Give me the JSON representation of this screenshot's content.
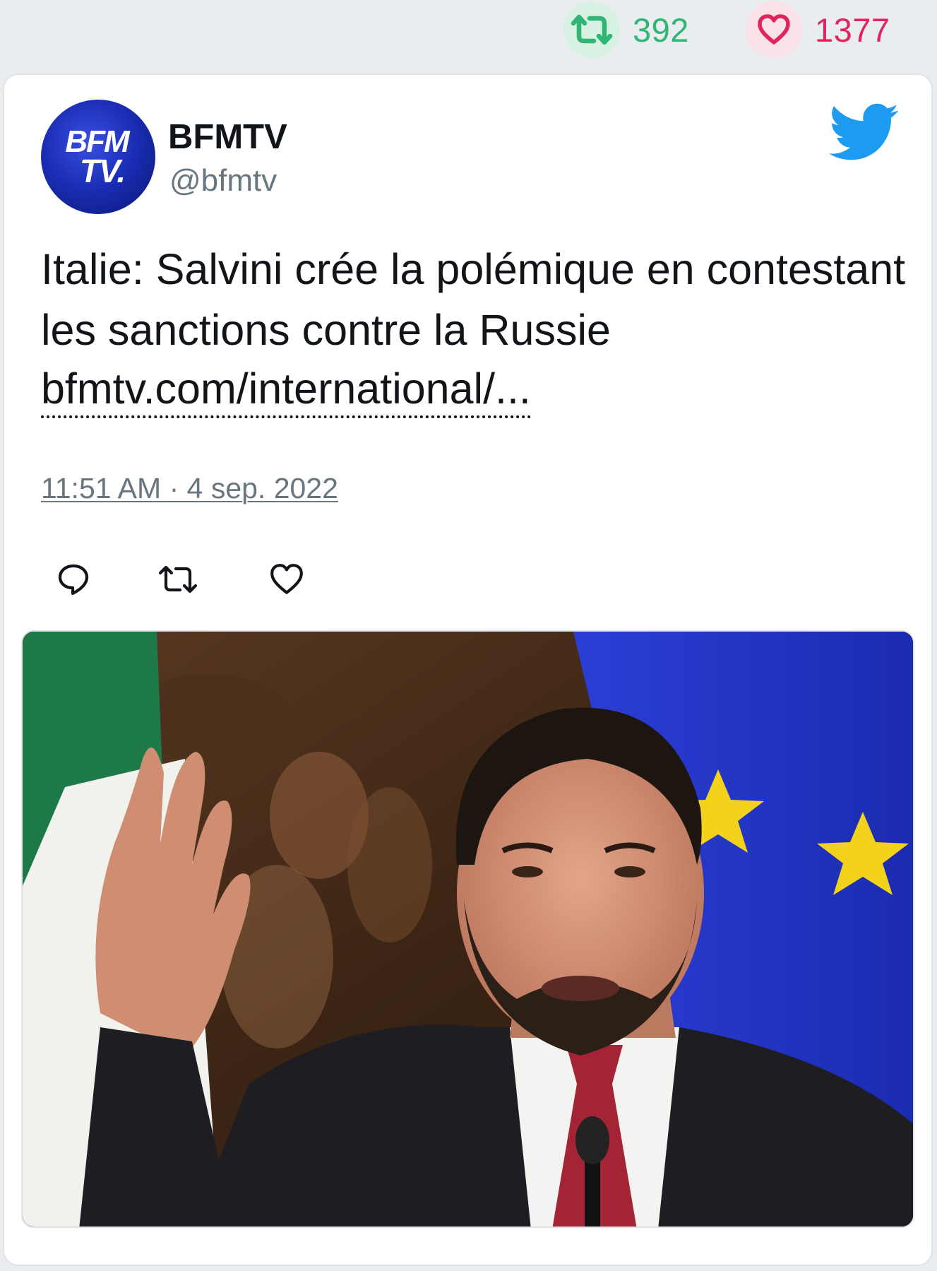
{
  "stats": {
    "retweets": "392",
    "likes": "1377"
  },
  "tweet": {
    "author_name": "BFMTV",
    "author_handle": "@bfmtv",
    "avatar_text_line1": "BFM",
    "avatar_text_line2": "TV.",
    "text": "Italie: Salvini crée la polémique en contestant les sanctions contre la Russie",
    "link": "bfmtv.com/international/...",
    "timestamp": "11:51 AM · 4 sep. 2022"
  },
  "icons": {
    "retweet": "retweet-icon",
    "like": "heart-icon",
    "reply": "reply-icon",
    "brand": "twitter-bird-icon"
  },
  "colors": {
    "retweet_green": "#2fb574",
    "like_red": "#e0245e",
    "twitter_blue": "#1d9bf0",
    "muted_gray": "#68767f"
  }
}
